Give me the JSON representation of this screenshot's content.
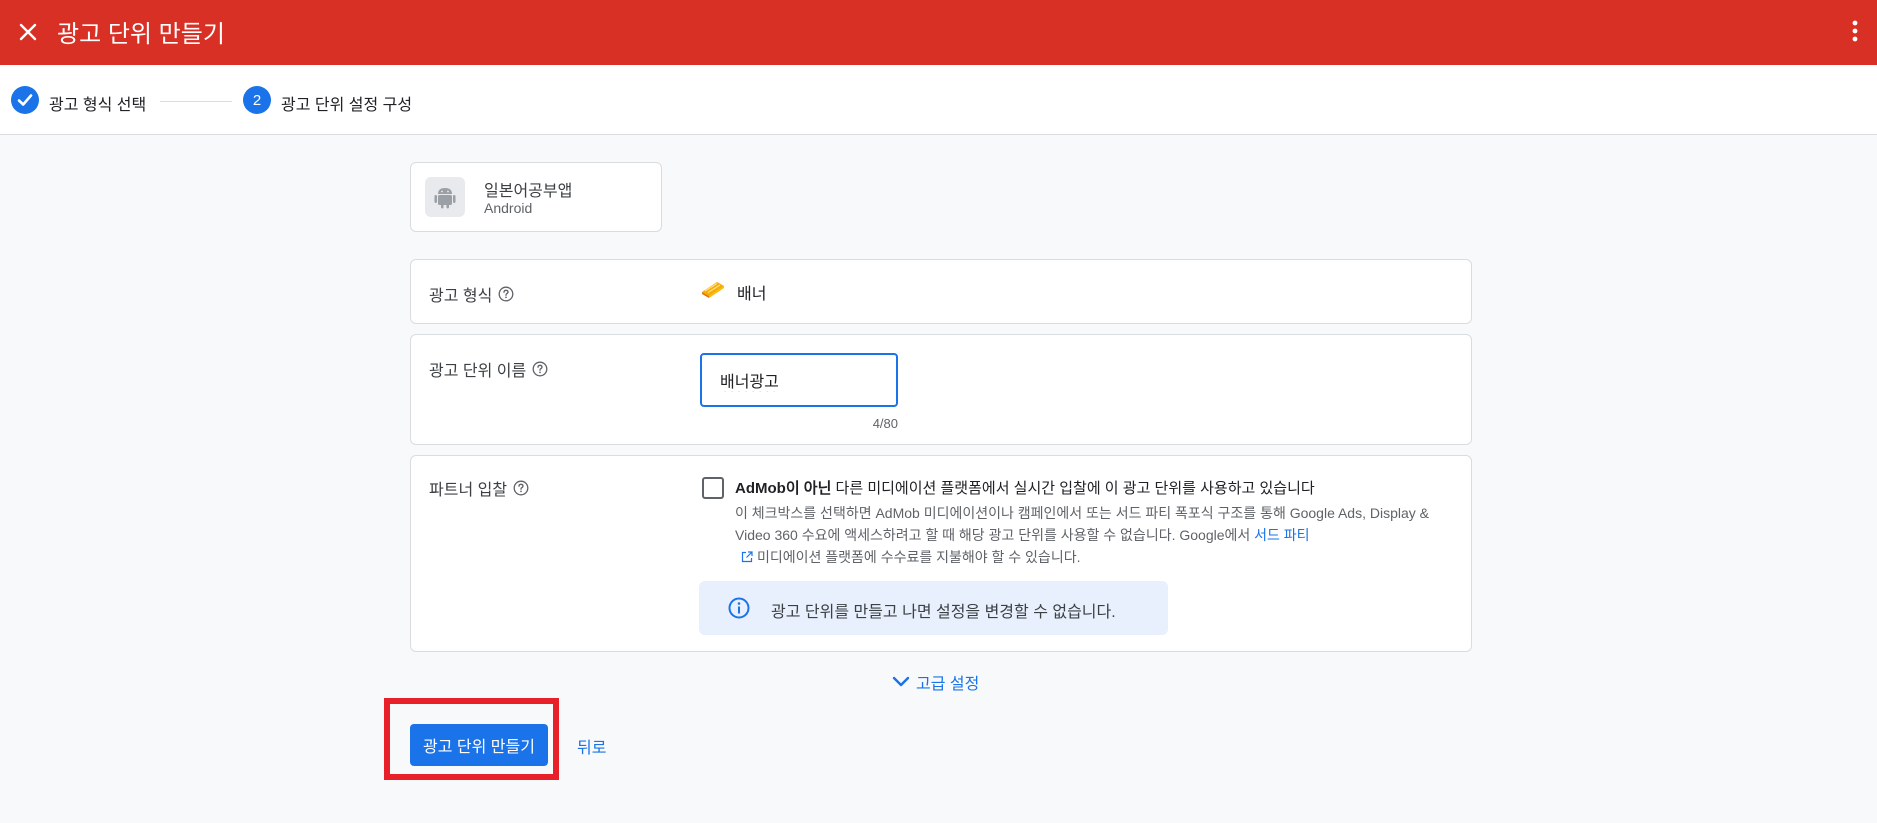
{
  "topbar": {
    "title": "광고 단위 만들기",
    "close_icon": "close-icon",
    "more_icon": "more-vert-icon",
    "background_color": "#d93025"
  },
  "stepper": {
    "steps": [
      {
        "label": "광고 형식 선택",
        "state": "completed"
      },
      {
        "number": "2",
        "label": "광고 단위 설정 구성",
        "state": "active"
      }
    ],
    "accent_color": "#1a73e8"
  },
  "app": {
    "name": "일본어공부앱",
    "platform": "Android",
    "icon": "android-icon"
  },
  "format": {
    "label": "광고 형식",
    "value": "배너",
    "icon": "banner-icon"
  },
  "ad_unit_name": {
    "label": "광고 단위 이름",
    "value": "배너광고",
    "char_count": "4/80"
  },
  "partner_bidding": {
    "label": "파트너 입찰",
    "checked": false,
    "title_bold": "AdMob이 아닌",
    "title_rest": " 다른 미디에이션 플랫폼에서 실시간 입찰에 이 광고 단위를 사용하고 있습니다",
    "desc_part1": "이 체크박스를 선택하면 AdMob 미디에이션이나 캠페인에서 또는 서드 파티 폭포식 구조를 통해 Google Ads, Display & Video 360 수요에 액세스하려고 할 때 해당 광고 단위를 사용할 수 없습니다. Google에서 ",
    "desc_link": "서드 파티",
    "desc_part2": "미디에이션 플랫폼에 수수료를 지불해야 할 수 있습니다.",
    "info_text": "광고 단위를 만들고 나면 설정을 변경할 수 없습니다."
  },
  "advanced": {
    "label": "고급 설정"
  },
  "actions": {
    "create_label": "광고 단위 만들기",
    "back_label": "뒤로"
  }
}
